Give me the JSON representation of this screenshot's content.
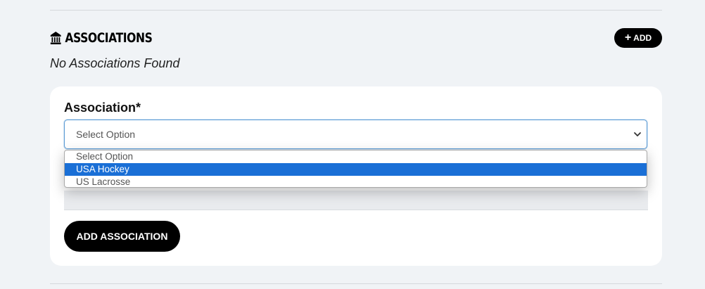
{
  "section": {
    "title": "ASSOCIATIONS",
    "add_label": "ADD",
    "empty_message": "No Associations Found"
  },
  "form": {
    "field_label": "Association*",
    "select_value": "Select Option",
    "options": [
      "Select Option",
      "USA Hockey",
      "US Lacrosse"
    ],
    "highlighted_option": "USA Hockey",
    "submit_label": "ADD ASSOCIATION"
  },
  "icons": {
    "section": "bank-building-icon",
    "add": "plus-icon",
    "select": "chevron-down-icon"
  },
  "colors": {
    "background": "#f0f3f6",
    "button": "#000000",
    "highlight": "#1a6fd6",
    "focus_border": "#5b9bd5"
  }
}
